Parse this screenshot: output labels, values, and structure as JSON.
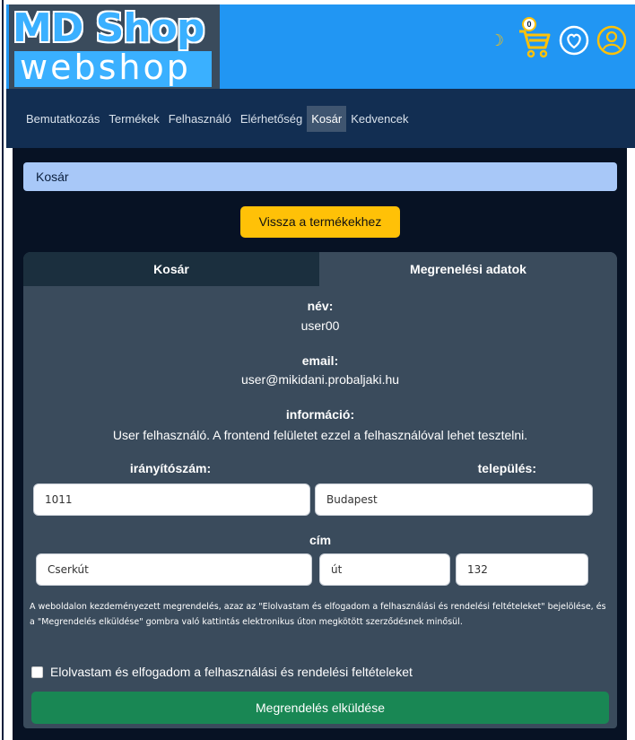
{
  "logo": {
    "top": "MD Shop",
    "bottom": "webshop"
  },
  "header": {
    "moon_icon": "moon-icon",
    "cart_badge": "0",
    "cart_icon": "cart-icon",
    "heart_icon": "heart-icon",
    "user_icon": "user-icon",
    "accent": "#ffc107"
  },
  "nav": {
    "items": [
      {
        "label": "Bemutatkozás"
      },
      {
        "label": "Termékek"
      },
      {
        "label": "Felhasználó"
      },
      {
        "label": "Elérhetőség"
      },
      {
        "label": "Kosár"
      },
      {
        "label": "Kedvencek"
      }
    ],
    "active": "Kosár"
  },
  "breadcrumb": "Kosár",
  "back_button": "Vissza a termékekhez",
  "tabs": {
    "cart": "Kosár",
    "order": "Megrenelési adatok"
  },
  "order": {
    "name_label": "név:",
    "name_value": "user00",
    "email_label": "email:",
    "email_value": "user@mikidani.probaljaki.hu",
    "info_label": "információ:",
    "info_value": "User felhasználó. A frontend felületet ezzel a felhasználóval lehet tesztelni.",
    "zip_label": "irányítószám:",
    "zip_value": "1011",
    "city_label": "település:",
    "city_value": "Budapest",
    "address_label": "cím",
    "street_value": "Cserkút",
    "street_type_value": "út",
    "house_number_value": "132",
    "terms_text": "A weboldalon kezdeményezett megrendelés, azaz az \"Elolvastam és elfogadom a felhasználási és rendelési feltételeket\" bejelölése, és a \"Megrendelés elküldése\" gombra való kattintás elektronikus úton megkötött szerződésnek minősül.",
    "checkbox_label": "Elolvastam és elfogadom a felhasználási és rendelési feltételeket",
    "submit_label": "Megrendelés elküldése"
  }
}
